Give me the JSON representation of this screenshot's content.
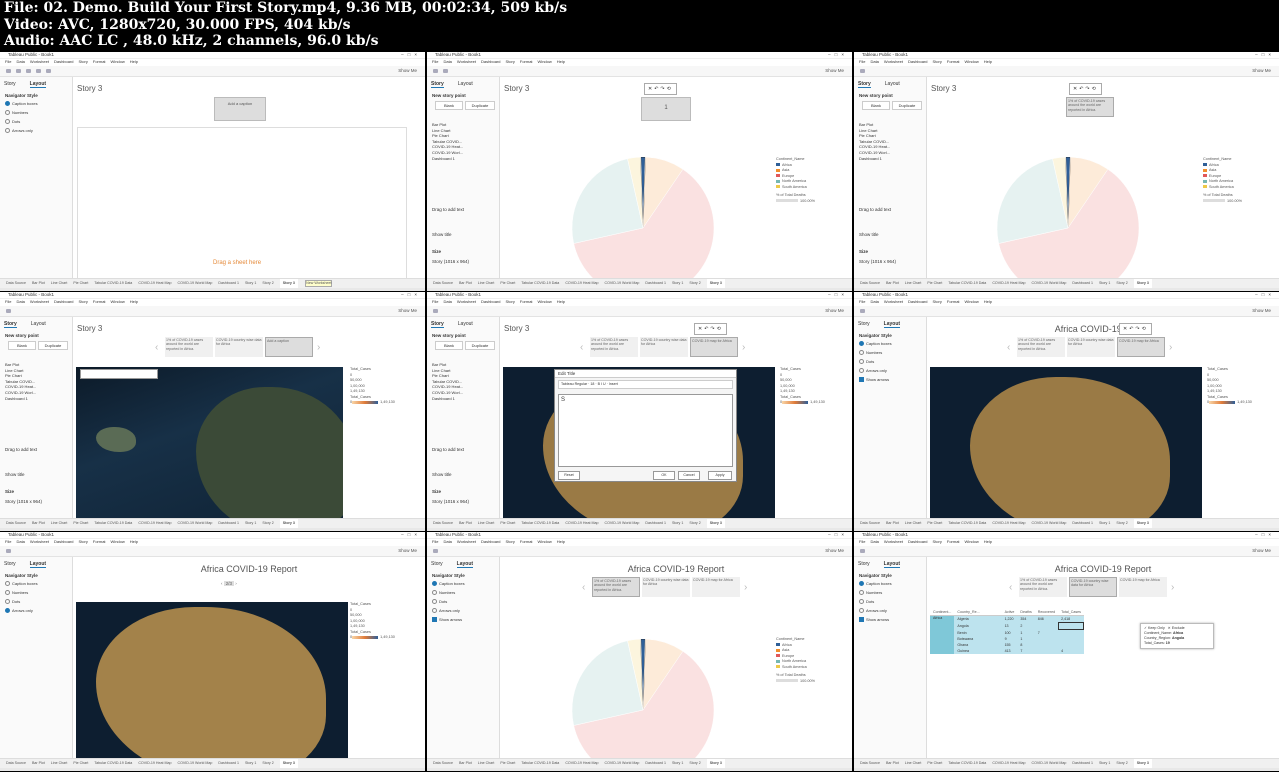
{
  "file_info": {
    "line1": "File: 02. Demo. Build Your First Story.mp4, 9.36 MB, 00:02:34, 509 kb/s",
    "line2": "Video: AVC, 1280x720, 30.000 FPS, 404 kb/s",
    "line3": "Audio: AAC LC , 48.0 kHz, 2 channels, 96.0 kb/s"
  },
  "app": {
    "window_title": "Tableau Public - Book1",
    "menu": [
      "File",
      "Data",
      "Worksheet",
      "Dashboard",
      "Story",
      "Format",
      "Window",
      "Help"
    ],
    "show_me": "Show Me",
    "side_tabs": {
      "story": "Story",
      "layout": "Layout"
    },
    "new_story_point": "New story point",
    "blank": "Blank",
    "duplicate": "Duplicate",
    "sheets": [
      "Bar Plot",
      "Line Chart",
      "Pie Chart",
      "Tabular COVID...",
      "COVID-19 Heat...",
      "COVID-19 Worl...",
      "Dashboard 1"
    ],
    "drag_text": "Drag to add text",
    "show_title": "Show title",
    "size_label": "Size",
    "size_value": "Story (1016 x 964)",
    "navigator_style": "Navigator Style",
    "nav_options": [
      "Caption boxes",
      "Numbers",
      "Dots",
      "Arrows only"
    ],
    "show_arrows": "Show arrows",
    "bottom_tabs": [
      "Data Source",
      "Bar Plot",
      "Line Chart",
      "Pie Chart",
      "Tabular COVID-19 Data",
      "COVID-19 Heat Map",
      "COVID-19 World Map",
      "Dashboard 1",
      "Story 1",
      "Story 2",
      "Story 3"
    ],
    "user": "Ranjan Rout",
    "new_worksheet_tip": "New Worksheet"
  },
  "story": {
    "title_default": "Story 3",
    "title_final": "Africa COVID-19 Report",
    "add_caption": "Add a caption",
    "drop_hint": "Drag a sheet here",
    "caption_typing": "1",
    "captions": [
      "1% of COVID-19 cases around the world are reported in Africa.",
      "COVID-19 country wise data for Africa",
      "COVID-19 map for Africa"
    ],
    "page_indicator": "2/3"
  },
  "legend_pie": {
    "title": "Continent_Name",
    "items": [
      {
        "name": "Africa",
        "color": "#2f5f98"
      },
      {
        "name": "Asia",
        "color": "#f28e2b"
      },
      {
        "name": "Europe",
        "color": "#e15759"
      },
      {
        "name": "North America",
        "color": "#76b7b2"
      },
      {
        "name": "South America",
        "color": "#edc948"
      }
    ],
    "measure": "% of Total Deaths",
    "measure_value": "100.00%"
  },
  "legend_map": {
    "title": "Total_Cases",
    "sizes": [
      "0",
      "50,000",
      "1,00,000",
      "1,49,130"
    ],
    "color_title": "Total_Cases",
    "color_min": "0",
    "color_max": "1,49,130"
  },
  "edit_title_dialog": {
    "title": "Edit Title",
    "font": "Tableau Regular",
    "size": "18",
    "insert": "Insert",
    "typed": "S",
    "reset": "Reset",
    "ok": "OK",
    "cancel": "Cancel",
    "apply": "Apply"
  },
  "table": {
    "headers": [
      "Continent...",
      "Country_Re...",
      "Active",
      "Deaths",
      "Recovered",
      "Total_Cases"
    ],
    "continent": "Africa",
    "rows": [
      [
        "Algeria",
        "1,220",
        "354",
        "846",
        "2,418"
      ],
      [
        "Angola",
        "13",
        "2",
        "",
        ""
      ],
      [
        "Benin",
        "100",
        "1",
        "7",
        ""
      ],
      [
        "Botswana",
        "9",
        "1",
        "",
        ""
      ],
      [
        "Ghana",
        "155",
        "8",
        "",
        ""
      ],
      [
        "Guinea",
        "413",
        "7",
        "",
        "4"
      ]
    ],
    "tooltip": {
      "keep_only": "Keep Only",
      "exclude": "Exclude",
      "continent_label": "Continent_Name:",
      "continent_value": "Africa",
      "country_label": "Country_Region:",
      "country_value": "Angola",
      "cases_label": "Total_Cases:",
      "cases_value": "19"
    }
  },
  "chart_data": {
    "type": "pie",
    "categories": [
      "Africa",
      "Asia",
      "Europe",
      "North America",
      "South America"
    ],
    "values": [
      1,
      9,
      62,
      25,
      3
    ],
    "title": "",
    "xlabel": "",
    "ylabel": ""
  }
}
